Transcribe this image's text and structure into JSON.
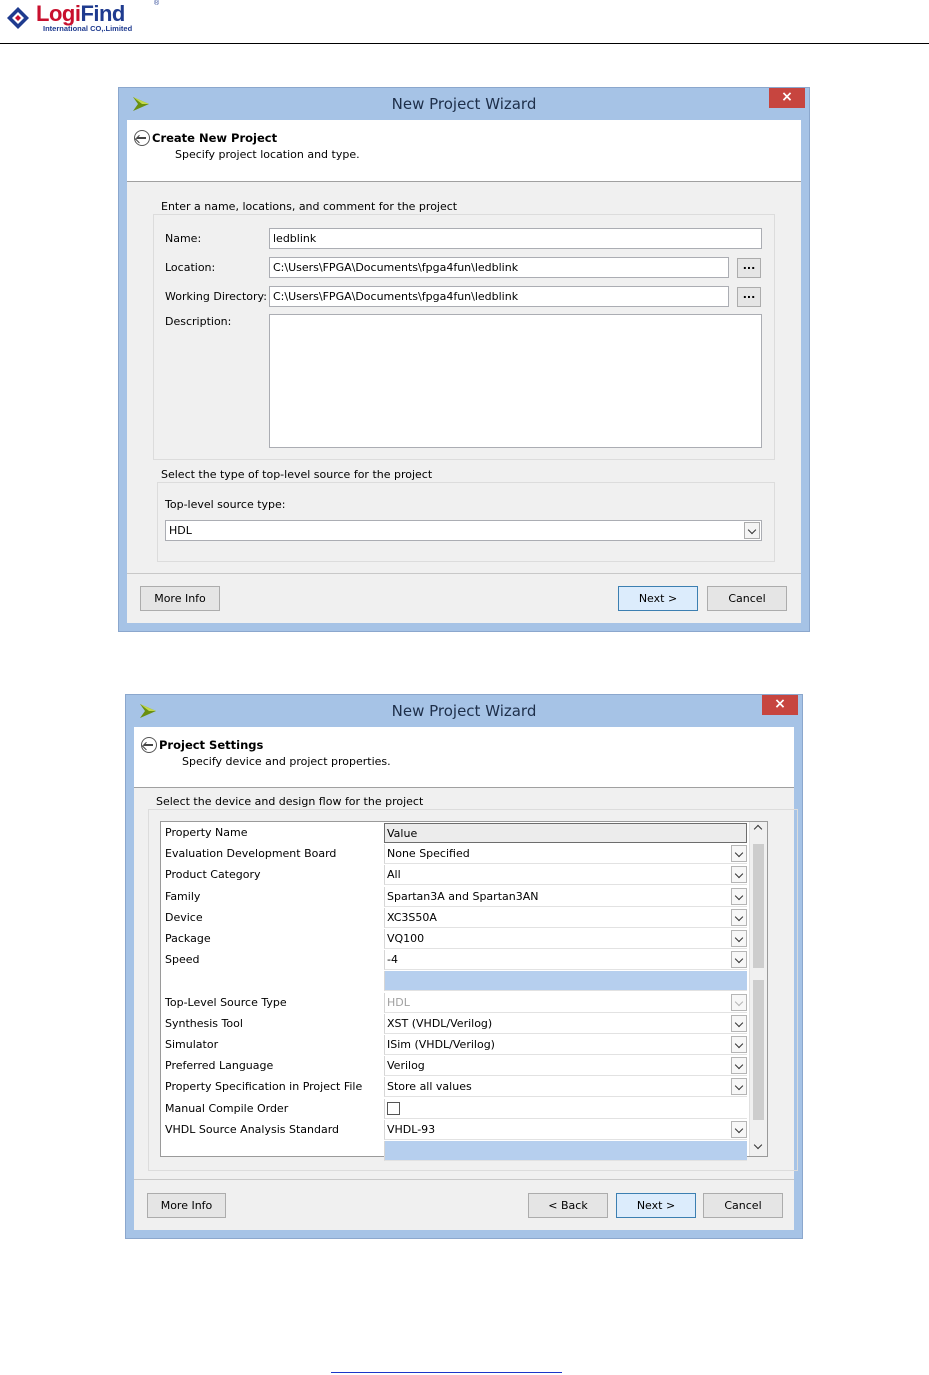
{
  "header": {
    "brand_part1": "Logi",
    "brand_part2": "Find",
    "registered": "®",
    "subtitle": "International CO,.Limited"
  },
  "colors": {
    "brand_red": "#c8102e",
    "brand_blue": "#1f3b8f",
    "title_bar": "#a6c3e6",
    "close_red": "#c7453f",
    "selection_blue": "#b6cfee"
  },
  "icons": [
    "wizard-arrow-icon",
    "close-icon",
    "back-arrow-icon",
    "chevron-down-icon",
    "chevron-up-icon"
  ],
  "dialog1": {
    "window_title": "New Project Wizard",
    "close_glyph": "×",
    "page_title": "Create New Project",
    "page_subtitle": "Specify project location and type.",
    "group1_label": "Enter a name, locations, and comment for the project",
    "name_label": "Name:",
    "name_value": "ledblink",
    "location_label": "Location:",
    "location_value": "C:\\Users\\FPGA\\Documents\\fpga4fun\\ledblink",
    "workdir_label": "Working Directory:",
    "workdir_value": "C:\\Users\\FPGA\\Documents\\fpga4fun\\ledblink",
    "browse_label": "...",
    "description_label": "Description:",
    "description_value": "",
    "group2_label": "Select the type of top-level source for the project",
    "source_type_label": "Top-level source type:",
    "source_type_value": "HDL",
    "more_info": "More Info",
    "next": "Next >",
    "cancel": "Cancel"
  },
  "dialog2": {
    "window_title": "New Project Wizard",
    "close_glyph": "×",
    "page_title": "Project Settings",
    "page_subtitle": "Specify device and project properties.",
    "group_label": "Select the device and design flow for the project",
    "columns": [
      "Property Name",
      "Value"
    ],
    "rows": [
      {
        "name": "Evaluation Development Board",
        "value": "None Specified"
      },
      {
        "name": "Product Category",
        "value": "All"
      },
      {
        "name": "Family",
        "value": "Spartan3A and Spartan3AN"
      },
      {
        "name": "Device",
        "value": "XC3S50A"
      },
      {
        "name": "Package",
        "value": "VQ100"
      },
      {
        "name": "Speed",
        "value": "-4"
      },
      {
        "name": "",
        "value": ""
      },
      {
        "name": "Top-Level Source Type",
        "value": "HDL"
      },
      {
        "name": "Synthesis Tool",
        "value": "XST (VHDL/Verilog)"
      },
      {
        "name": "Simulator",
        "value": "ISim (VHDL/Verilog)"
      },
      {
        "name": "Preferred Language",
        "value": "Verilog"
      },
      {
        "name": "Property Specification in Project File",
        "value": "Store all values"
      },
      {
        "name": "Manual Compile Order",
        "value": ""
      },
      {
        "name": "VHDL Source Analysis Standard",
        "value": "VHDL-93"
      },
      {
        "name": "",
        "value": ""
      }
    ],
    "more_info": "More Info",
    "back": "< Back",
    "next": "Next >",
    "cancel": "Cancel"
  }
}
